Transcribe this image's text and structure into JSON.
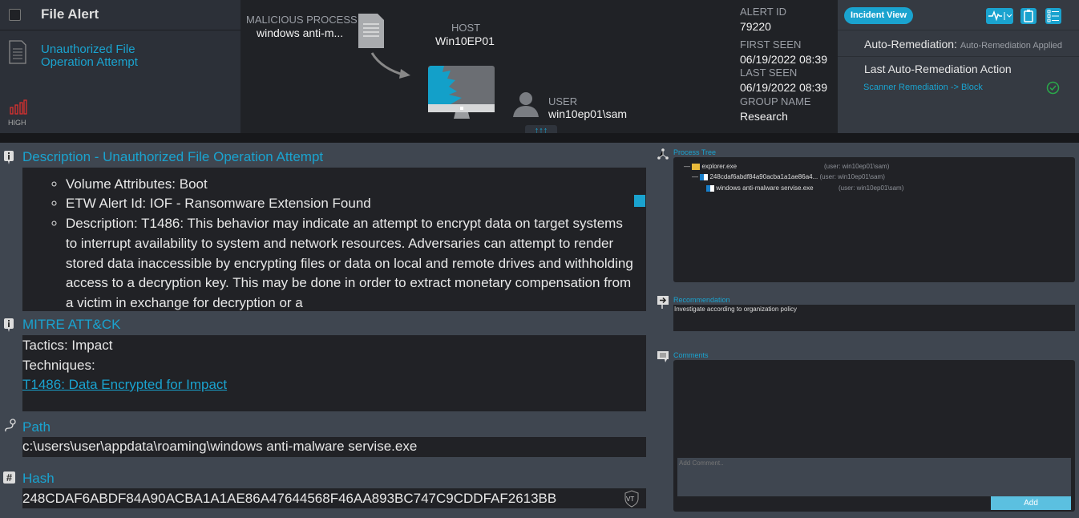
{
  "alert": {
    "type": "File Alert",
    "name": "Unauthorized File Operation Attempt",
    "severity": "HIGH",
    "severity_color": "#d9302f"
  },
  "flow": {
    "process_label": "MALICIOUS PROCESS",
    "process_value": "windows anti-m...",
    "host_label": "HOST",
    "host_value": "Win10EP01",
    "user_label": "USER",
    "user_value": "win10ep01\\sam",
    "expand": "↑↑↑"
  },
  "meta": {
    "alert_id_label": "ALERT ID",
    "alert_id": "79220",
    "first_seen_label": "FIRST SEEN",
    "first_seen": "06/19/2022 08:39",
    "last_seen_label": "LAST SEEN",
    "last_seen": "06/19/2022 08:39",
    "group_label": "GROUP NAME",
    "group": "Research"
  },
  "remediation": {
    "incident_view": "Incident View",
    "auto_label": "Auto-Remediation:",
    "auto_value": "Auto-Remediation Applied",
    "last_label": "Last Auto-Remediation Action",
    "last_action": "Scanner Remediation -> Block"
  },
  "description": {
    "title": "Description - Unauthorized File Operation Attempt",
    "items": [
      "Volume Attributes: Boot",
      "ETW Alert Id: IOF - Ransomware Extension Found",
      "Description: T1486: This behavior may indicate an attempt to encrypt data on target systems to interrupt availability to system and network resources. Adversaries can attempt to render stored data inaccessible by encrypting files or data on local and remote drives and withholding access to a decryption key. This may be done in order to extract monetary compensation from a victim in exchange for decryption or a"
    ]
  },
  "mitre": {
    "title": "MITRE ATT&CK",
    "tactics": "Tactics: Impact",
    "techniques": "Techniques:",
    "technique_link": "T1486: Data Encrypted for Impact"
  },
  "path": {
    "title": "Path",
    "value": "c:\\users\\user\\appdata\\roaming\\windows anti-malware servise.exe"
  },
  "hash": {
    "title": "Hash",
    "value": "248CDAF6ABDF84A90ACBA1A1AE86A47644568F46AA893BC747C9CDDFAF2613BB",
    "vt": "VT"
  },
  "process_tree": {
    "title": "Process Tree",
    "rows": [
      {
        "name": "explorer.exe",
        "user": "(user: win10ep01\\sam)"
      },
      {
        "name": "248cdaf6abdf84a90acba1a1ae86a4...",
        "user": "(user: win10ep01\\sam)"
      },
      {
        "name": "windows anti-malware servise.exe",
        "user": "(user: win10ep01\\sam)"
      }
    ]
  },
  "recommendation": {
    "title": "Recommendation",
    "text": "Investigate according to organization policy"
  },
  "comments": {
    "title": "Comments",
    "placeholder": "Add Comment..",
    "add": "Add"
  },
  "colors": {
    "accent": "#1aa3cf",
    "success": "#2aa84a"
  }
}
